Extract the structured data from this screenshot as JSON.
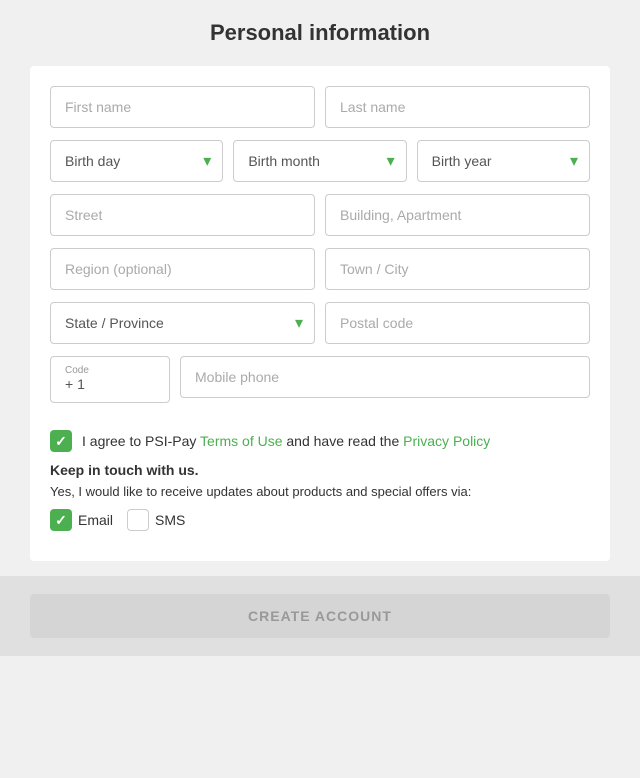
{
  "page": {
    "title": "Personal information"
  },
  "form": {
    "first_name_placeholder": "First name",
    "last_name_placeholder": "Last name",
    "birth_day_placeholder": "Birth day",
    "birth_month_placeholder": "Birth month",
    "birth_year_placeholder": "Birth year",
    "street_placeholder": "Street",
    "building_placeholder": "Building, Apartment",
    "region_placeholder": "Region (optional)",
    "town_placeholder": "Town / City",
    "state_placeholder": "State / Province",
    "postal_placeholder": "Postal code",
    "phone_code_label": "Code",
    "phone_code_value": "+ 1",
    "mobile_placeholder": "Mobile phone"
  },
  "checkbox": {
    "terms_text": "I agree to PSI-Pay ",
    "terms_link": "Terms of Use",
    "terms_mid": " and have read the ",
    "privacy_link": "Privacy Policy",
    "keep_in_touch_title": "Keep in touch with us.",
    "keep_in_touch_sub": "Yes, I would like to receive updates about products and special offers via:",
    "email_label": "Email",
    "sms_label": "SMS"
  },
  "footer": {
    "create_button": "CREATE ACCOUNT"
  }
}
